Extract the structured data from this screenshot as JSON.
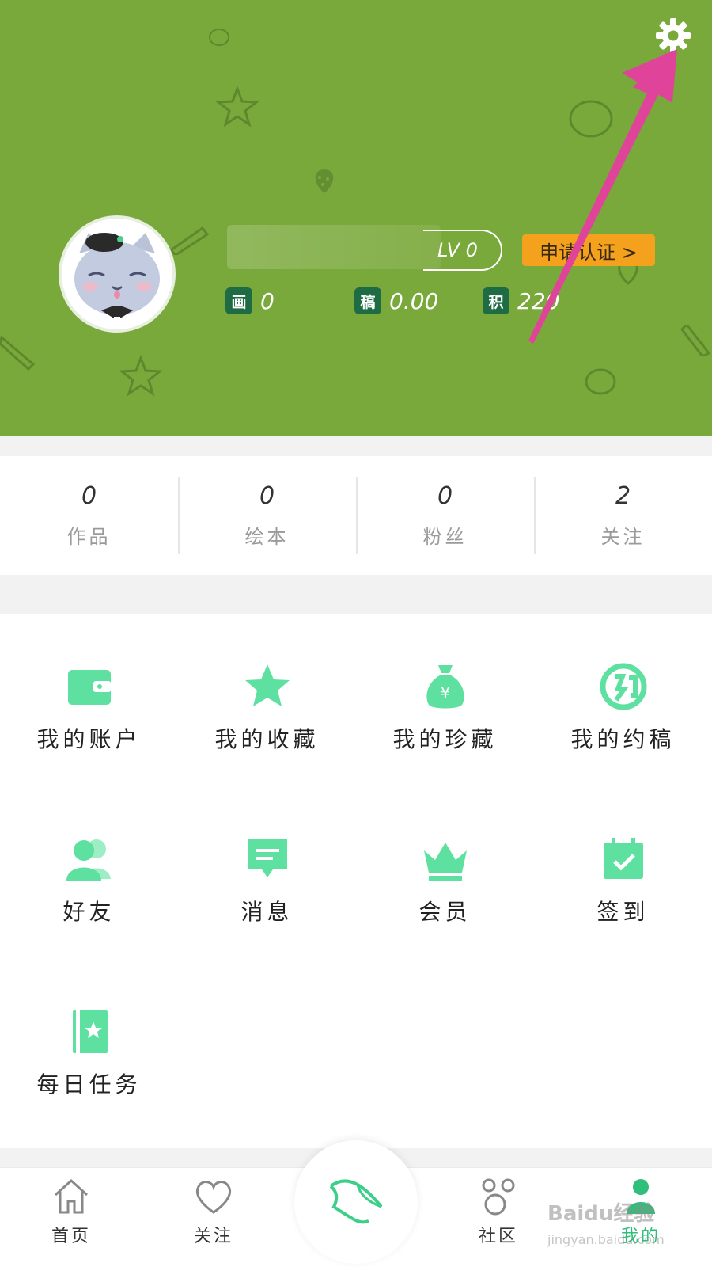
{
  "header": {
    "level": "LV 0",
    "certify_button": "申请认证 >",
    "stats": [
      {
        "badge": "画",
        "value": "0"
      },
      {
        "badge": "稿",
        "value": "0.00"
      },
      {
        "badge": "积",
        "value": "220"
      }
    ]
  },
  "counts": [
    {
      "value": "0",
      "label": "作品"
    },
    {
      "value": "0",
      "label": "绘本"
    },
    {
      "value": "0",
      "label": "粉丝"
    },
    {
      "value": "2",
      "label": "关注"
    }
  ],
  "menu": [
    {
      "label": "我的账户",
      "icon": "wallet-icon"
    },
    {
      "label": "我的收藏",
      "icon": "star-icon"
    },
    {
      "label": "我的珍藏",
      "icon": "money-bag-icon"
    },
    {
      "label": "我的约稿",
      "icon": "commission-icon"
    },
    {
      "label": "好友",
      "icon": "friends-icon"
    },
    {
      "label": "消息",
      "icon": "message-icon"
    },
    {
      "label": "会员",
      "icon": "crown-icon"
    },
    {
      "label": "签到",
      "icon": "calendar-check-icon"
    },
    {
      "label": "每日任务",
      "icon": "task-book-icon"
    }
  ],
  "nav": [
    {
      "label": "首页",
      "icon": "home-icon"
    },
    {
      "label": "关注",
      "icon": "heart-icon"
    },
    {
      "label": "社区",
      "icon": "community-icon"
    },
    {
      "label": "我的",
      "icon": "profile-icon"
    }
  ],
  "watermark": {
    "text": "Baidu经验",
    "sub": "jingyan.baidu.com"
  },
  "colors": {
    "header_bg": "#7aa93b",
    "accent_green": "#5ee0a0",
    "certify_bg": "#f4a11e",
    "arrow": "#e0449a"
  }
}
